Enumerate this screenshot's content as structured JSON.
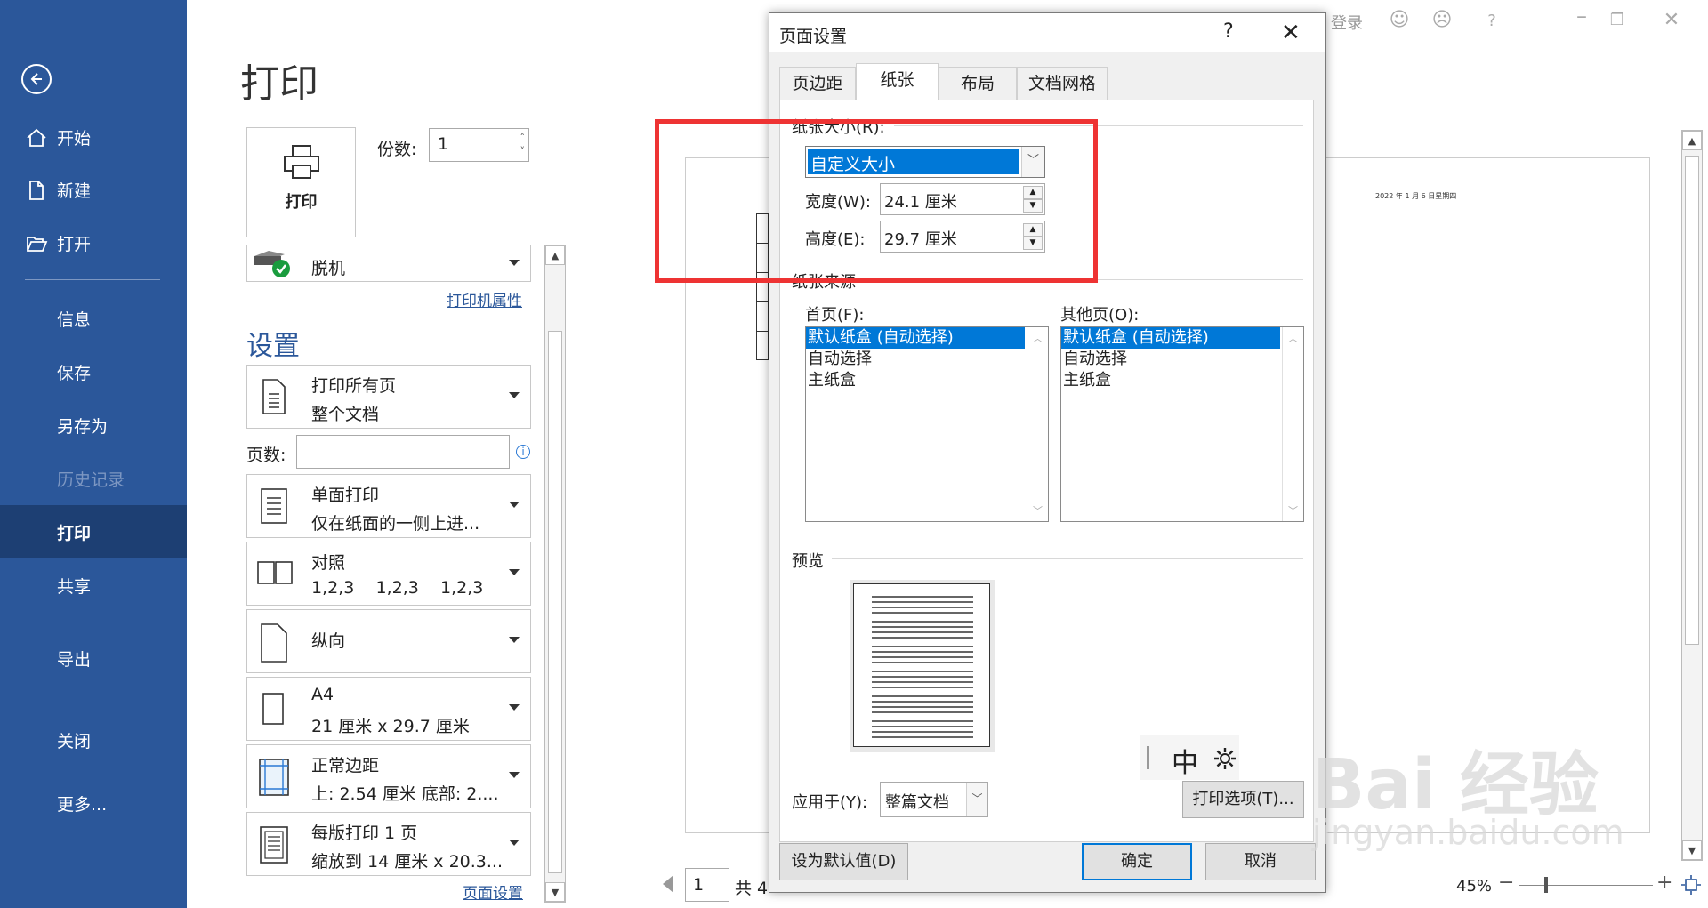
{
  "nav": {
    "items": [
      {
        "label": "开始"
      },
      {
        "label": "新建"
      },
      {
        "label": "打开"
      },
      {
        "label": "信息"
      },
      {
        "label": "保存"
      },
      {
        "label": "另存为"
      },
      {
        "label": "历史记录"
      },
      {
        "label": "打印"
      },
      {
        "label": "共享"
      },
      {
        "label": "导出"
      },
      {
        "label": "关闭"
      },
      {
        "label": "更多..."
      }
    ]
  },
  "print": {
    "title": "打印",
    "copies_label": "份数:",
    "copies_value": "1",
    "print_button": "打印",
    "printer_name": "脱机",
    "printer_props": "打印机属性",
    "settings_header": "设置",
    "pages_label": "页数:",
    "settings": [
      {
        "l1": "打印所有页",
        "l2": "整个文档"
      },
      {
        "l1": "单面打印",
        "l2": "仅在纸面的一侧上进..."
      },
      {
        "l1": "对照",
        "l2": "1,2,3    1,2,3    1,2,3"
      },
      {
        "l1": "纵向",
        "l2": ""
      },
      {
        "l1": "A4",
        "l2": "21 厘米 x 29.7 厘米"
      },
      {
        "l1": "正常边距",
        "l2": "上: 2.54 厘米 底部: 2...."
      },
      {
        "l1": "每版打印 1 页",
        "l2": "缩放到 14 厘米 x 20.3..."
      }
    ],
    "page_setup_link": "页面设置"
  },
  "preview": {
    "date_text": "2022 年 1 月 6 日星期四",
    "page_value": "1",
    "page_total": "共 4",
    "zoom": "45%"
  },
  "topbar": {
    "sign_in": "登录"
  },
  "dialog": {
    "title": "页面设置",
    "help": "?",
    "tabs": [
      "页边距",
      "纸张",
      "布局",
      "文档网格"
    ],
    "paper_size_label": "纸张大小(R):",
    "paper_size_value": "自定义大小",
    "width_label": "宽度(W):",
    "width_value": "24.1 厘米",
    "height_label": "高度(E):",
    "height_value": "29.7 厘米",
    "paper_source_label": "纸张来源",
    "first_page_label": "首页(F):",
    "other_pages_label": "其他页(O):",
    "source_options": [
      "默认纸盒 (自动选择)",
      "自动选择",
      "主纸盒"
    ],
    "preview_label": "预览",
    "apply_label": "应用于(Y):",
    "apply_value": "整篇文档",
    "print_options": "打印选项(T)...",
    "set_default": "设为默认值(D)",
    "ok": "确定",
    "cancel": "取消"
  },
  "ime": {
    "mode": "中"
  },
  "watermark": {
    "brand": "Bai 经验",
    "url": "jingyan.baidu.com"
  },
  "colors": {
    "nav_bg": "#2b579a",
    "nav_active": "#1d3f73",
    "selection": "#0078d7",
    "annotation": "#ee3333"
  }
}
